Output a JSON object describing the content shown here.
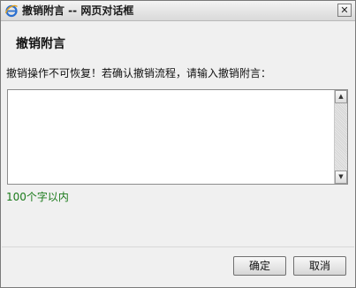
{
  "window": {
    "title": "撤销附言 -- 网页对话框",
    "close_glyph": "✕"
  },
  "dialog": {
    "heading": "撤销附言",
    "prompt": "撤销操作不可恢复！若确认撤销流程，请输入撤销附言：",
    "textarea_value": "",
    "limit_note": "100个字以内"
  },
  "buttons": {
    "ok_label": "确定",
    "cancel_label": "取消"
  },
  "scrollbar": {
    "up_glyph": "▲",
    "down_glyph": "▼"
  },
  "colors": {
    "limit_note": "#1a7a1a",
    "ie_icon": "#2a6fcf"
  }
}
